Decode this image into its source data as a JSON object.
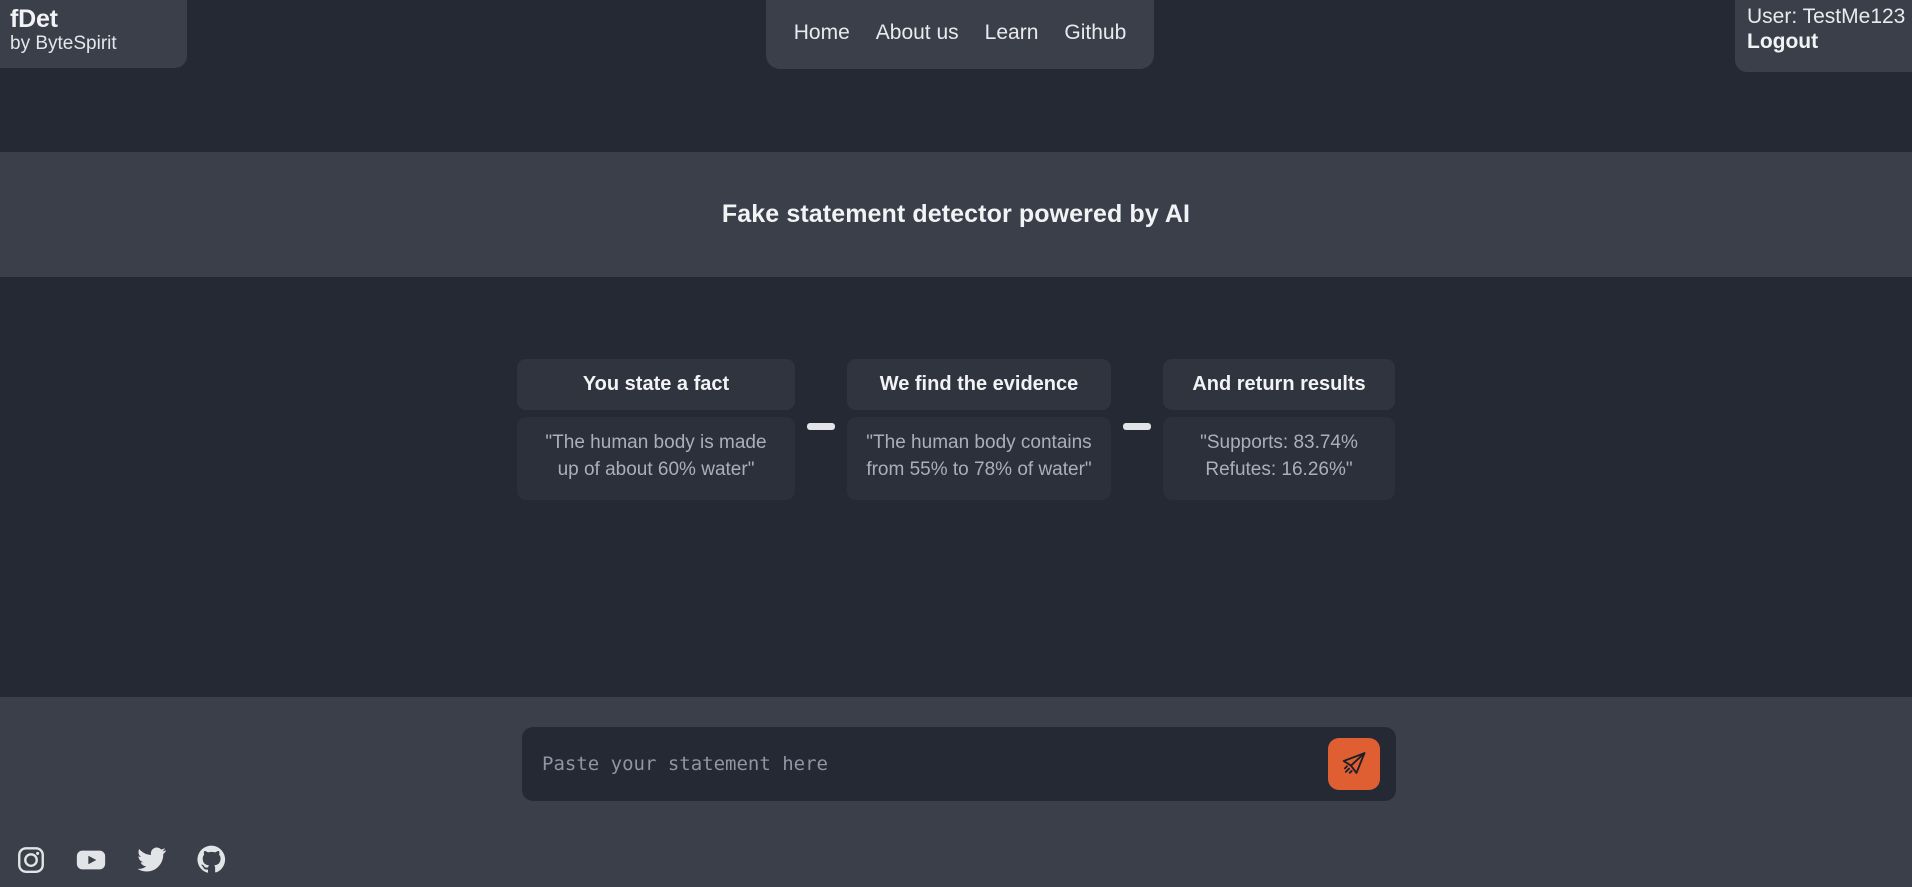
{
  "brand": {
    "name": "fDet",
    "tagline": "by ByteSpirit"
  },
  "nav": {
    "items": [
      {
        "label": "Home"
      },
      {
        "label": "About us"
      },
      {
        "label": "Learn"
      },
      {
        "label": "Github"
      }
    ]
  },
  "account": {
    "user_label": "User: TestMe123",
    "logout_label": "Logout"
  },
  "hero": {
    "title": "Fake statement detector powered by AI"
  },
  "steps": [
    {
      "title": "You state a fact",
      "example": "\"The human body is made up of about 60% water\""
    },
    {
      "title": "We find the evidence",
      "example": "\"The human body contains from 55% to 78% of water\""
    },
    {
      "title": "And return results",
      "example": "\"Supports: 83.74% Refutes: 16.26%\""
    }
  ],
  "composer": {
    "placeholder": "Paste your statement here",
    "value": "",
    "send_icon": "send-plane-icon",
    "send_color": "#e05f32"
  },
  "footer": {
    "social": [
      {
        "name": "instagram-icon"
      },
      {
        "name": "youtube-icon"
      },
      {
        "name": "twitter-icon"
      },
      {
        "name": "github-icon"
      }
    ]
  },
  "theme": {
    "background": "#242933",
    "panel": "#3b3f4a",
    "card": "#2b303b",
    "card_head": "#2f343f",
    "accent": "#e05f32",
    "text": "#e9eaee",
    "muted": "#a9afbb"
  }
}
